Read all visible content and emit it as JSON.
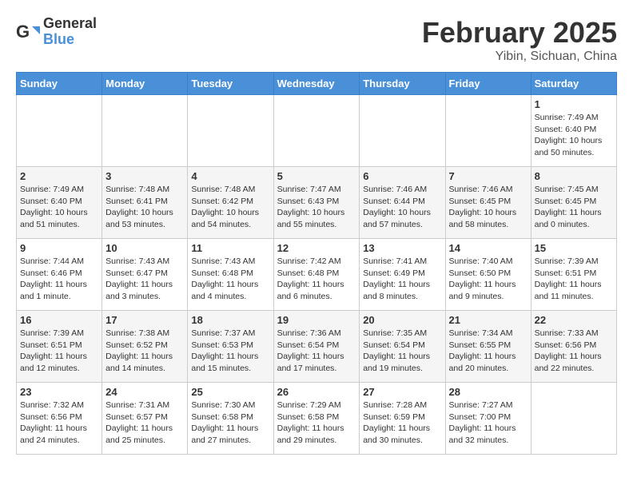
{
  "header": {
    "logo_general": "General",
    "logo_blue": "Blue",
    "month_year": "February 2025",
    "location": "Yibin, Sichuan, China"
  },
  "days_of_week": [
    "Sunday",
    "Monday",
    "Tuesday",
    "Wednesday",
    "Thursday",
    "Friday",
    "Saturday"
  ],
  "weeks": [
    [
      {
        "day": "",
        "info": ""
      },
      {
        "day": "",
        "info": ""
      },
      {
        "day": "",
        "info": ""
      },
      {
        "day": "",
        "info": ""
      },
      {
        "day": "",
        "info": ""
      },
      {
        "day": "",
        "info": ""
      },
      {
        "day": "1",
        "info": "Sunrise: 7:49 AM\nSunset: 6:40 PM\nDaylight: 10 hours\nand 50 minutes."
      }
    ],
    [
      {
        "day": "2",
        "info": "Sunrise: 7:49 AM\nSunset: 6:40 PM\nDaylight: 10 hours\nand 51 minutes."
      },
      {
        "day": "3",
        "info": "Sunrise: 7:48 AM\nSunset: 6:41 PM\nDaylight: 10 hours\nand 53 minutes."
      },
      {
        "day": "4",
        "info": "Sunrise: 7:48 AM\nSunset: 6:42 PM\nDaylight: 10 hours\nand 54 minutes."
      },
      {
        "day": "5",
        "info": "Sunrise: 7:47 AM\nSunset: 6:43 PM\nDaylight: 10 hours\nand 55 minutes."
      },
      {
        "day": "6",
        "info": "Sunrise: 7:46 AM\nSunset: 6:44 PM\nDaylight: 10 hours\nand 57 minutes."
      },
      {
        "day": "7",
        "info": "Sunrise: 7:46 AM\nSunset: 6:45 PM\nDaylight: 10 hours\nand 58 minutes."
      },
      {
        "day": "8",
        "info": "Sunrise: 7:45 AM\nSunset: 6:45 PM\nDaylight: 11 hours\nand 0 minutes."
      }
    ],
    [
      {
        "day": "9",
        "info": "Sunrise: 7:44 AM\nSunset: 6:46 PM\nDaylight: 11 hours\nand 1 minute."
      },
      {
        "day": "10",
        "info": "Sunrise: 7:43 AM\nSunset: 6:47 PM\nDaylight: 11 hours\nand 3 minutes."
      },
      {
        "day": "11",
        "info": "Sunrise: 7:43 AM\nSunset: 6:48 PM\nDaylight: 11 hours\nand 4 minutes."
      },
      {
        "day": "12",
        "info": "Sunrise: 7:42 AM\nSunset: 6:48 PM\nDaylight: 11 hours\nand 6 minutes."
      },
      {
        "day": "13",
        "info": "Sunrise: 7:41 AM\nSunset: 6:49 PM\nDaylight: 11 hours\nand 8 minutes."
      },
      {
        "day": "14",
        "info": "Sunrise: 7:40 AM\nSunset: 6:50 PM\nDaylight: 11 hours\nand 9 minutes."
      },
      {
        "day": "15",
        "info": "Sunrise: 7:39 AM\nSunset: 6:51 PM\nDaylight: 11 hours\nand 11 minutes."
      }
    ],
    [
      {
        "day": "16",
        "info": "Sunrise: 7:39 AM\nSunset: 6:51 PM\nDaylight: 11 hours\nand 12 minutes."
      },
      {
        "day": "17",
        "info": "Sunrise: 7:38 AM\nSunset: 6:52 PM\nDaylight: 11 hours\nand 14 minutes."
      },
      {
        "day": "18",
        "info": "Sunrise: 7:37 AM\nSunset: 6:53 PM\nDaylight: 11 hours\nand 15 minutes."
      },
      {
        "day": "19",
        "info": "Sunrise: 7:36 AM\nSunset: 6:54 PM\nDaylight: 11 hours\nand 17 minutes."
      },
      {
        "day": "20",
        "info": "Sunrise: 7:35 AM\nSunset: 6:54 PM\nDaylight: 11 hours\nand 19 minutes."
      },
      {
        "day": "21",
        "info": "Sunrise: 7:34 AM\nSunset: 6:55 PM\nDaylight: 11 hours\nand 20 minutes."
      },
      {
        "day": "22",
        "info": "Sunrise: 7:33 AM\nSunset: 6:56 PM\nDaylight: 11 hours\nand 22 minutes."
      }
    ],
    [
      {
        "day": "23",
        "info": "Sunrise: 7:32 AM\nSunset: 6:56 PM\nDaylight: 11 hours\nand 24 minutes."
      },
      {
        "day": "24",
        "info": "Sunrise: 7:31 AM\nSunset: 6:57 PM\nDaylight: 11 hours\nand 25 minutes."
      },
      {
        "day": "25",
        "info": "Sunrise: 7:30 AM\nSunset: 6:58 PM\nDaylight: 11 hours\nand 27 minutes."
      },
      {
        "day": "26",
        "info": "Sunrise: 7:29 AM\nSunset: 6:58 PM\nDaylight: 11 hours\nand 29 minutes."
      },
      {
        "day": "27",
        "info": "Sunrise: 7:28 AM\nSunset: 6:59 PM\nDaylight: 11 hours\nand 30 minutes."
      },
      {
        "day": "28",
        "info": "Sunrise: 7:27 AM\nSunset: 7:00 PM\nDaylight: 11 hours\nand 32 minutes."
      },
      {
        "day": "",
        "info": ""
      }
    ]
  ]
}
